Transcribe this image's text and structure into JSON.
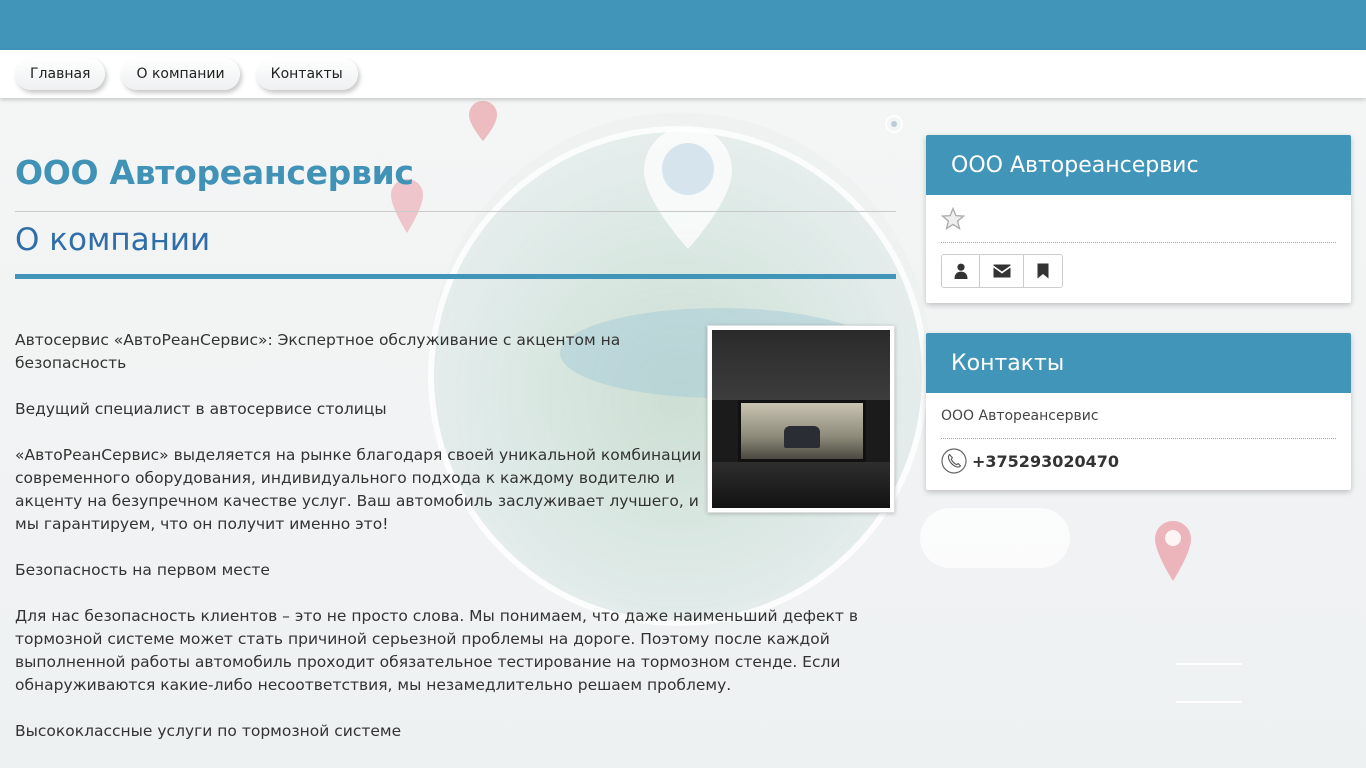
{
  "nav": {
    "items": [
      "Главная",
      "О компании",
      "Контакты"
    ]
  },
  "main": {
    "title": "ООО Автореансервис",
    "section": "О компании",
    "paragraphs": [
      "Автосервис «АвтоРеанСервис»: Экспертное обслуживание с акцентом на безопасность",
      "Ведущий специалист в автосервисе столицы",
      "«АвтоРеанСервис» выделяется на рынке благодаря своей уникальной комбинации современного оборудования, индивидуального подхода к каждому водителю и акценту на безупречном качестве услуг. Ваш автомобиль заслуживает лучшего, и мы гарантируем, что он получит именно это!",
      "Безопасность на первом месте",
      "Для нас безопасность клиентов – это не просто слова. Мы понимаем, что даже наименьший дефект в тормозной системе может стать причиной серьезной проблемы на дороге. Поэтому после каждой выполненной работы автомобиль проходит обязательное тестирование на тормозном стенде. Если обнаруживаются какие-либо несоответствия, мы незамедлительно решаем проблему.",
      "Высококлассные услуги по тормозной системе"
    ],
    "image_icon": "garage-photo"
  },
  "sidebar": {
    "company_card": {
      "title": "ООО Автореансервис",
      "rating_icon": "star-outline-icon",
      "buttons": [
        "user-icon",
        "envelope-icon",
        "bookmark-icon"
      ]
    },
    "contacts_card": {
      "title": "Контакты",
      "company": "ООО Автореансервис",
      "phone_icon": "phone-icon",
      "phone": "+375293020470"
    }
  },
  "colors": {
    "brand": "#4095b9",
    "title": "#4092b6",
    "section_title": "#2f6ea8"
  }
}
